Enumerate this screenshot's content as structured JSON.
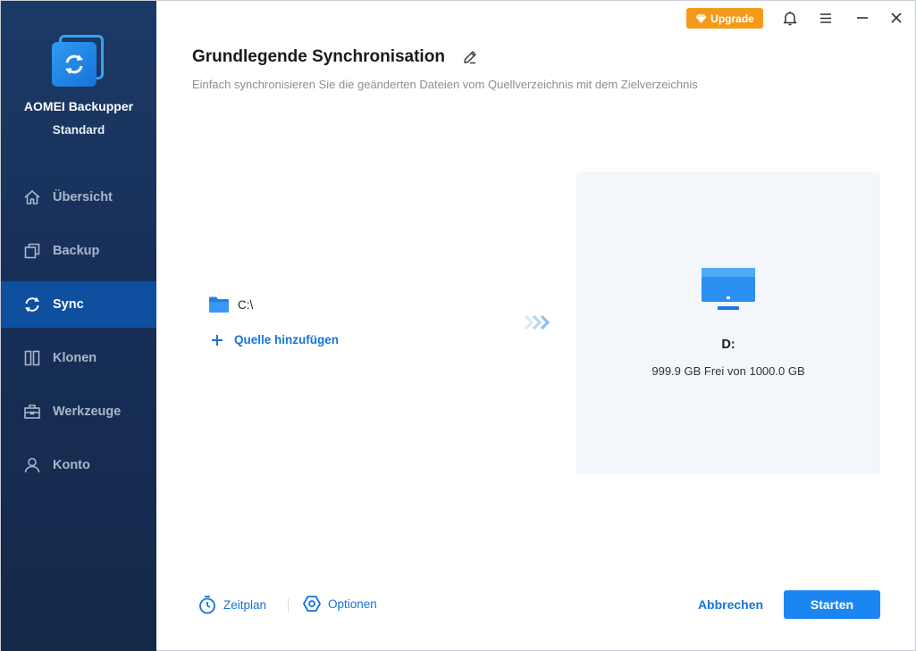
{
  "app": {
    "name": "AOMEI Backupper",
    "edition": "Standard"
  },
  "topbar": {
    "upgrade_label": "Upgrade"
  },
  "sidebar": {
    "items": [
      {
        "label": "Übersicht",
        "icon": "home-icon",
        "active": false
      },
      {
        "label": "Backup",
        "icon": "copy-icon",
        "active": false
      },
      {
        "label": "Sync",
        "icon": "sync-icon",
        "active": true
      },
      {
        "label": "Klonen",
        "icon": "clone-icon",
        "active": false
      },
      {
        "label": "Werkzeuge",
        "icon": "toolbox-icon",
        "active": false
      },
      {
        "label": "Konto",
        "icon": "user-icon",
        "active": false
      }
    ]
  },
  "main": {
    "title": "Grundlegende Synchronisation",
    "subtitle": "Einfach synchronisieren Sie die geänderten Dateien vom Quellverzeichnis mit dem Zielverzeichnis",
    "source": {
      "path": "C:\\",
      "add_label": "Quelle hinzufügen"
    },
    "destination": {
      "name": "D:",
      "info": "999.9 GB Frei von 1000.0 GB"
    }
  },
  "footer": {
    "schedule_label": "Zeitplan",
    "options_label": "Optionen",
    "cancel_label": "Abbrechen",
    "start_label": "Starten"
  },
  "colors": {
    "sidebar_bg": "#172f58",
    "active_item": "#0e4fa0",
    "accent": "#1673d9",
    "primary_button": "#1b86f2",
    "upgrade": "#f49a1a"
  }
}
